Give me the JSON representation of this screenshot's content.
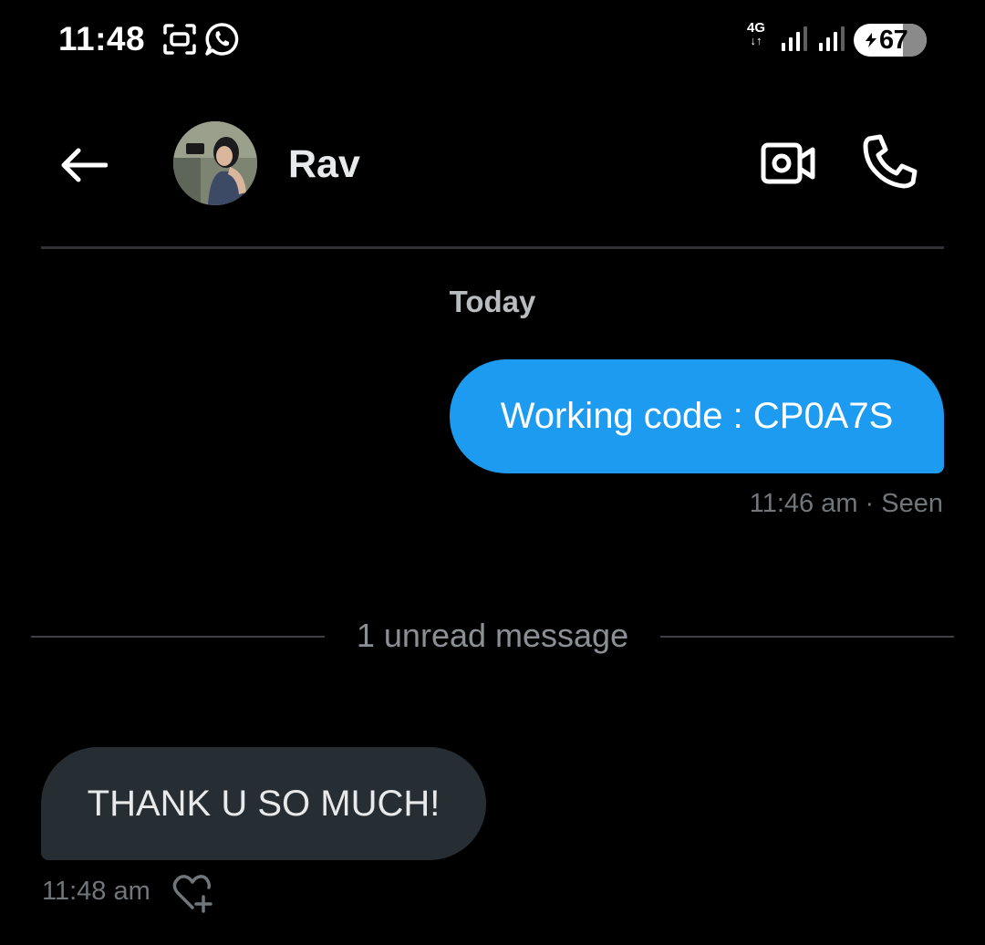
{
  "status_bar": {
    "time": "11:48",
    "network_type": "4G",
    "battery_level": "67",
    "icons": [
      "screen-record-icon",
      "whatsapp-icon",
      "signal-icon",
      "signal-icon",
      "battery-icon"
    ]
  },
  "header": {
    "contact_name": "Rav",
    "icons": [
      "arrow-left-icon",
      "video-camera-icon",
      "phone-icon"
    ]
  },
  "conversation": {
    "date_separator": "Today",
    "messages": [
      {
        "direction": "sent",
        "text": "Working code : CP0A7S",
        "meta": "11:46 am · Seen"
      },
      {
        "direction": "received",
        "text": "THANK U SO MUCH!",
        "meta": "11:48 am"
      }
    ],
    "unread_separator": "1 unread message"
  },
  "colors": {
    "background": "#000000",
    "sent_bubble": "#1d9bf0",
    "received_bubble": "#262d33",
    "muted_text": "#71767b"
  }
}
